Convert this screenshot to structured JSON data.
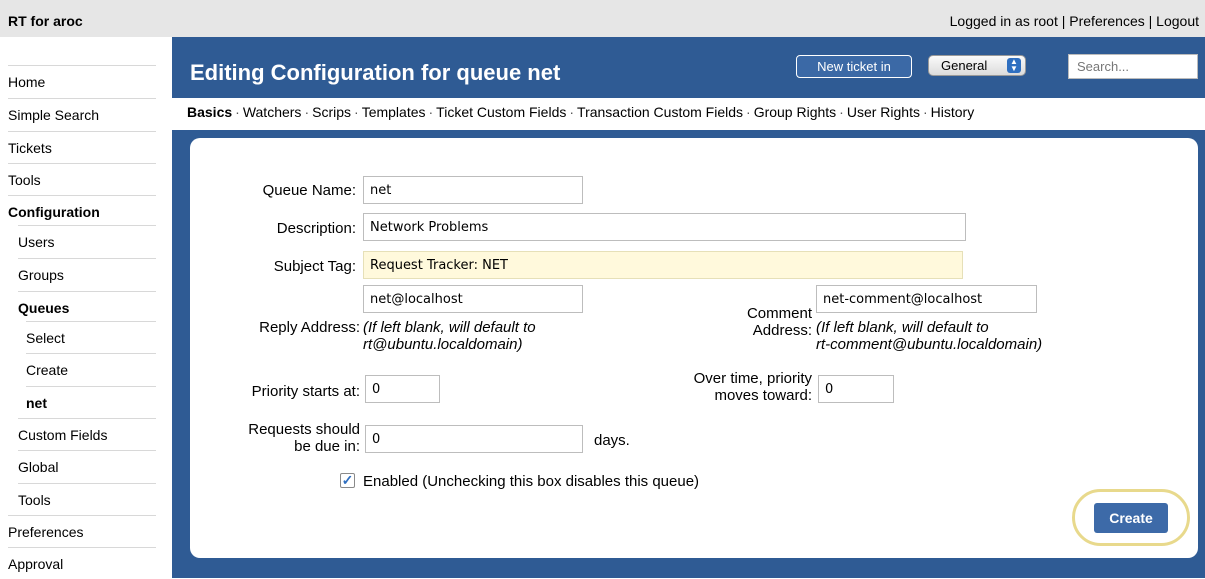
{
  "app": {
    "title": "RT for aroc"
  },
  "user_menu": {
    "logged_in": "Logged in as root",
    "sep1": " | ",
    "preferences": "Preferences",
    "sep2": " | ",
    "logout": "Logout"
  },
  "sidebar": {
    "items": [
      {
        "label": "Home"
      },
      {
        "label": "Simple Search"
      },
      {
        "label": "Tickets"
      },
      {
        "label": "Tools"
      },
      {
        "label": "Configuration"
      },
      {
        "label": "Users"
      },
      {
        "label": "Groups"
      },
      {
        "label": "Queues"
      },
      {
        "label": "Select"
      },
      {
        "label": "Create"
      },
      {
        "label": "net"
      },
      {
        "label": "Custom Fields"
      },
      {
        "label": "Global"
      },
      {
        "label": "Tools"
      },
      {
        "label": "Preferences"
      },
      {
        "label": "Approval"
      }
    ]
  },
  "header": {
    "title": "Editing Configuration for queue net",
    "new_ticket_label": "New ticket in",
    "queue_selected": "General",
    "search_placeholder": "Search..."
  },
  "tabs": [
    {
      "label": "Basics"
    },
    {
      "label": "Watchers"
    },
    {
      "label": "Scrips"
    },
    {
      "label": "Templates"
    },
    {
      "label": "Ticket Custom Fields"
    },
    {
      "label": "Transaction Custom Fields"
    },
    {
      "label": "Group Rights"
    },
    {
      "label": "User Rights"
    },
    {
      "label": "History"
    }
  ],
  "tab_separator": "·",
  "form": {
    "queue_name_label": "Queue Name:",
    "queue_name_value": "net",
    "description_label": "Description:",
    "description_value": "Network Problems",
    "subject_tag_label": "Subject Tag:",
    "subject_tag_value": "Request Tracker: NET",
    "reply_address_label": "Reply Address:",
    "reply_address_value": "net@localhost",
    "reply_hint_1": "(If left blank, will default to",
    "reply_hint_2": "rt@ubuntu.localdomain)",
    "comment_label_1": "Comment",
    "comment_label_2": "Address:",
    "comment_address_value": "net-comment@localhost",
    "comment_hint_1": "(If left blank, will default to",
    "comment_hint_2": "rt-comment@ubuntu.localdomain)",
    "priority_start_label": "Priority starts at:",
    "priority_start_value": "0",
    "priority_final_label_1": "Over time, priority",
    "priority_final_label_2": "moves toward:",
    "priority_final_value": "0",
    "due_label_1": "Requests should",
    "due_label_2": "be due in:",
    "due_value": "0",
    "due_unit": "days.",
    "enabled_label": "Enabled (Unchecking this box disables this queue)",
    "enabled_checked": true,
    "create_label": "Create"
  },
  "colors": {
    "header_bg": "#2f5b94",
    "topbar_bg": "#e6e6e6",
    "button_bg": "#3d6aa8",
    "highlight_ring": "#e8d98c",
    "subject_tag_bg": "#fff9dc"
  }
}
